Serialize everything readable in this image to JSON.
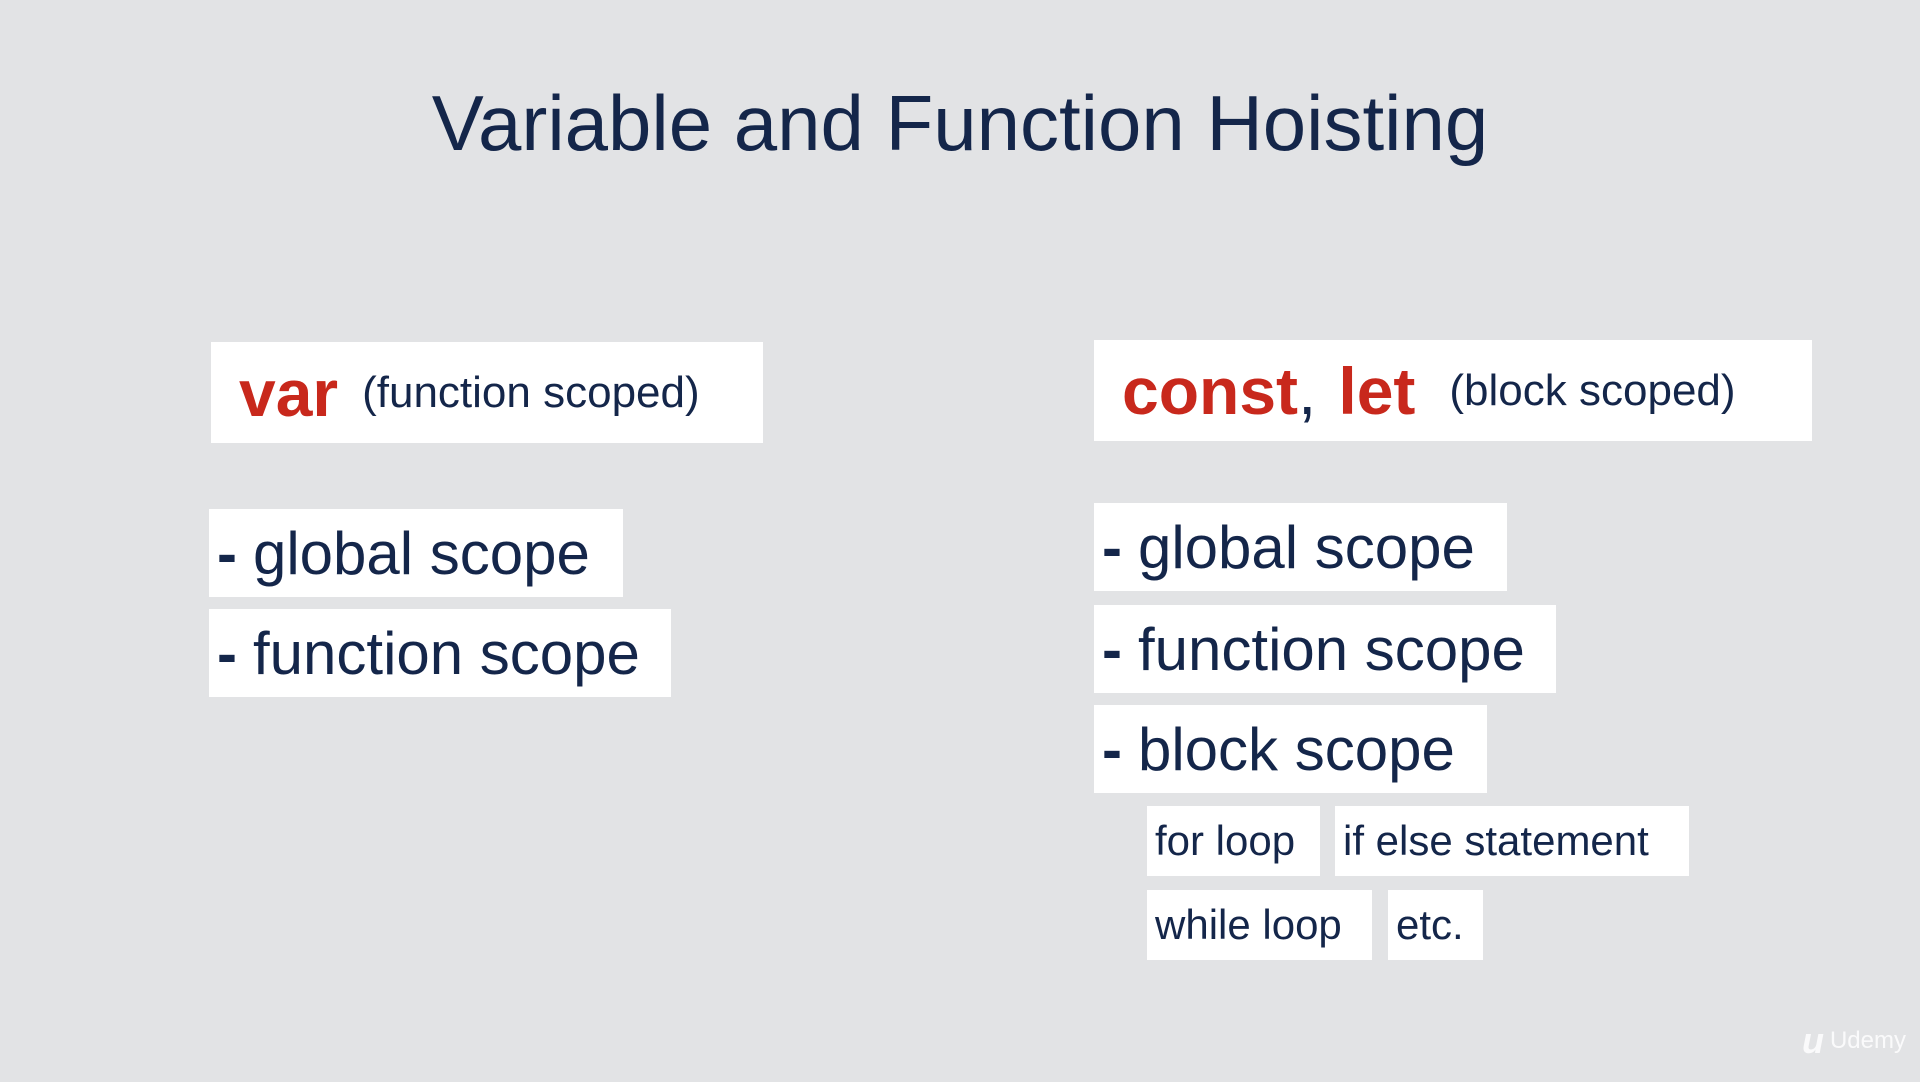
{
  "title": "Variable and Function Hoisting",
  "left": {
    "keyword": "var",
    "note": "(function scoped)",
    "items": [
      "global scope",
      "function scope"
    ]
  },
  "right": {
    "keyword1": "const",
    "separator": ",",
    "keyword2": "let",
    "note": "(block scoped)",
    "items": [
      "global scope",
      "function scope",
      "block scope"
    ],
    "examples": [
      "for loop",
      "if else statement",
      "while loop",
      "etc."
    ]
  },
  "dash": "-",
  "logo": {
    "text": "Udemy",
    "icon": "udemy-logo-icon"
  },
  "colors": {
    "background": "#e2e3e5",
    "text": "#14264a",
    "keyword": "#c8281c",
    "box": "#ffffff"
  }
}
